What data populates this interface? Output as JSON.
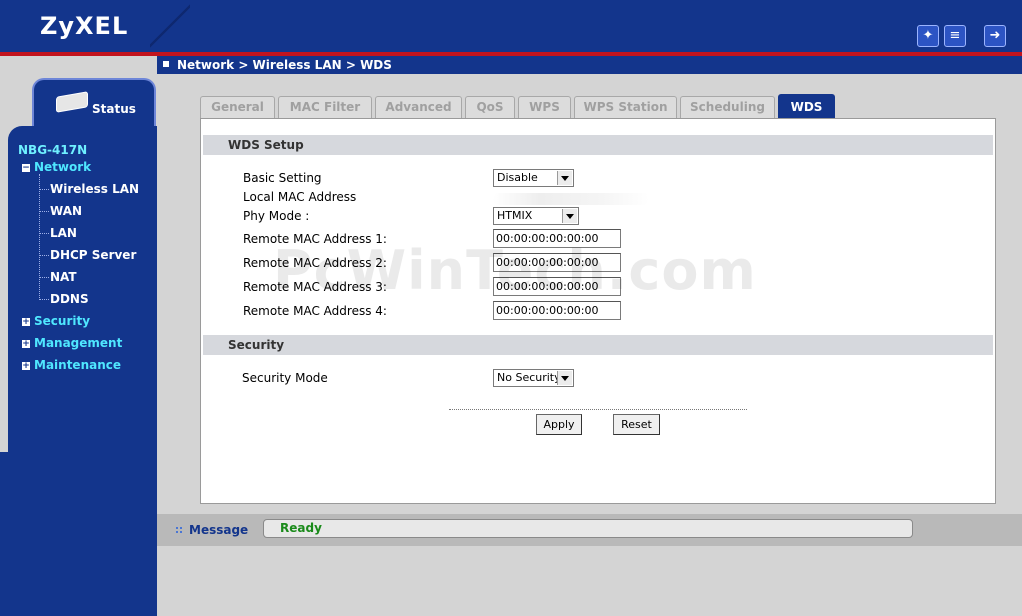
{
  "header": {
    "logo": "ZyXEL",
    "icons": [
      "wizard-icon",
      "notes-icon",
      "logout-icon"
    ]
  },
  "breadcrumb": "Network > Wireless LAN > WDS",
  "sidebar": {
    "status_tab": "Status",
    "device": "NBG-417N",
    "items": [
      {
        "label": "Network",
        "expanded": true
      },
      {
        "label": "Wireless LAN"
      },
      {
        "label": "WAN"
      },
      {
        "label": "LAN"
      },
      {
        "label": "DHCP Server"
      },
      {
        "label": "NAT"
      },
      {
        "label": "DDNS"
      },
      {
        "label": "Security"
      },
      {
        "label": "Management"
      },
      {
        "label": "Maintenance"
      }
    ]
  },
  "tabs": [
    {
      "label": "General"
    },
    {
      "label": "MAC Filter"
    },
    {
      "label": "Advanced"
    },
    {
      "label": "QoS"
    },
    {
      "label": "WPS"
    },
    {
      "label": "WPS Station"
    },
    {
      "label": "Scheduling"
    },
    {
      "label": "WDS",
      "active": true
    }
  ],
  "wds_setup": {
    "title": "WDS Setup",
    "basic_setting_label": "Basic Setting",
    "basic_setting_value": "Disable",
    "local_mac_label": "Local MAC Address",
    "phy_mode_label": "Phy Mode :",
    "phy_mode_value": "HTMIX",
    "remote1_label": "Remote MAC Address 1:",
    "remote1_value": "00:00:00:00:00:00",
    "remote2_label": "Remote MAC Address 2:",
    "remote2_value": "00:00:00:00:00:00",
    "remote3_label": "Remote MAC Address 3:",
    "remote3_value": "00:00:00:00:00:00",
    "remote4_label": "Remote MAC Address 4:",
    "remote4_value": "00:00:00:00:00:00"
  },
  "security": {
    "title": "Security",
    "mode_label": "Security Mode",
    "mode_value": "No Security"
  },
  "buttons": {
    "apply": "Apply",
    "reset": "Reset"
  },
  "watermark": "PcWinTech.com",
  "footer": {
    "message_label": "Message",
    "status": "Ready"
  },
  "colors": {
    "brand_blue": "#13358c",
    "accent_red": "#c2141e",
    "nav_cyan": "#4fe7ff",
    "ready_green": "#1a8a1a"
  }
}
